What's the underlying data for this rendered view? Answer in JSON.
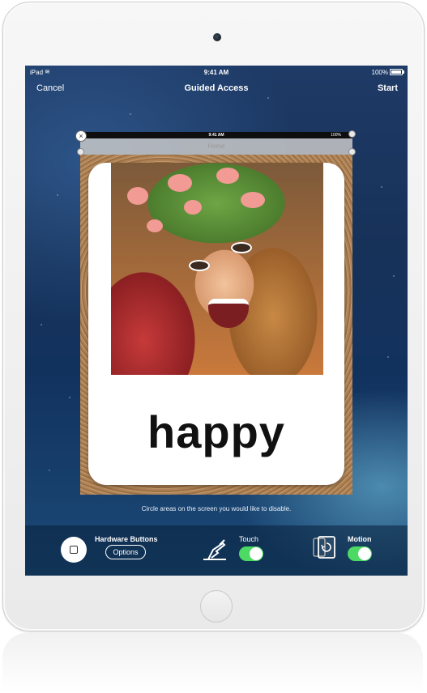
{
  "status": {
    "carrier": "iPad",
    "time": "9:41 AM",
    "battery": "100%",
    "battery_level": 1.0
  },
  "nav": {
    "cancel": "Cancel",
    "title": "Guided Access",
    "start": "Start"
  },
  "preview": {
    "status_time": "9:41 AM",
    "status_battery": "100%",
    "nav_label": "Home",
    "card_word": "happy"
  },
  "hint": "Circle areas on the screen you would like to disable.",
  "controls": {
    "hardware_buttons": "Hardware Buttons",
    "options": "Options",
    "touch": "Touch",
    "touch_on": true,
    "motion": "Motion",
    "motion_on": true
  },
  "colors": {
    "toggle_on": "#4cd964",
    "screen_bg": "#173259"
  },
  "icons": [
    "close-icon",
    "wifi-icon",
    "battery-icon",
    "hand-touch-icon",
    "device-rotate-icon",
    "home-button"
  ]
}
